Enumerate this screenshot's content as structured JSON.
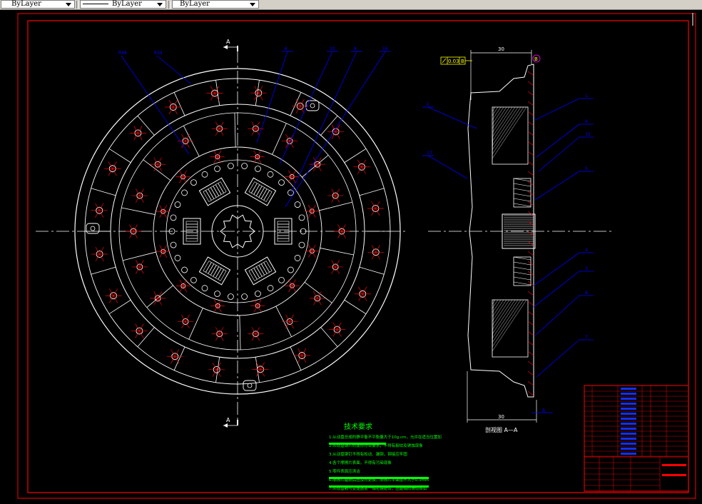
{
  "toolbar": {
    "layer_combo": {
      "value": "ByLayer"
    },
    "linetype_combo": {
      "value": "ByLayer"
    },
    "lineweight_combo": {
      "value": "ByLayer"
    }
  },
  "drawing": {
    "section_marker_label": "A",
    "section_view_caption": "剖视图 A—A",
    "dim_top": "30",
    "dim_bottom": "30",
    "tolerance_frame": "0.03",
    "datum_ref": "B",
    "datum_bottom": "B",
    "balloons_front": [
      "6",
      "10",
      "8",
      "16"
    ],
    "radius_labels": [
      "R48",
      "R54"
    ],
    "balloons_side": [
      "1",
      "6",
      "15",
      "5",
      "4",
      "3",
      "8",
      "7",
      "2",
      "17"
    ],
    "tech_title": "技术要求",
    "tech_notes": [
      "1.从动盘总成的静平衡不平衡量大于10g.cm，允许在适当位置加",
      "2.从动盘钢片的波形符合要求，不得有裂纹及锈蚀现象",
      "3.从动盘铆钉不得有松动、漏铆，铆接应牢固",
      "4.各个摩擦片表面，不得有污染现象",
      "5.零件表面应清洁",
      "6.摩擦片磨损后应及时更换，摩擦片平面度不大于0.3mm",
      "7.从动盘毂与变速器第一轴花键配合，应能轴向滑动自如"
    ],
    "colors": {
      "background": "#000000",
      "frame": "#ff0000",
      "geometry": "#ffffff",
      "centerline": "#ffffff",
      "leader": "#0000ff",
      "notes": "#00ff00",
      "accent": "#ff00ff",
      "datum": "#ffff00"
    }
  }
}
